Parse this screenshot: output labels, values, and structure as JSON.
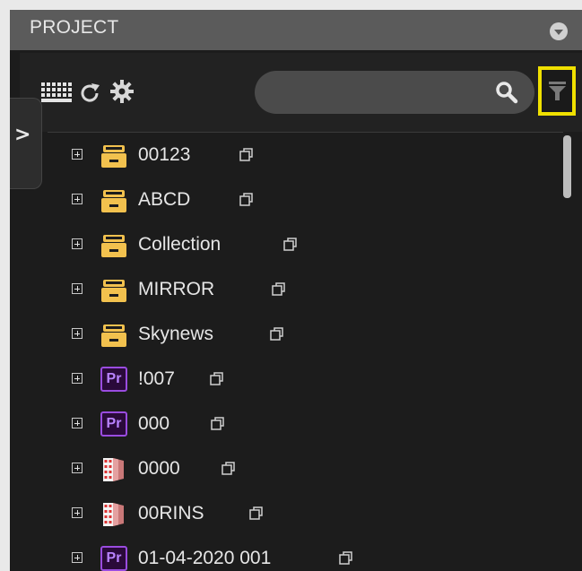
{
  "panel": {
    "title": "PROJECT"
  },
  "search": {
    "placeholder": "",
    "value": ""
  },
  "colors": {
    "header_bg": "#5b5b5b",
    "panel_bg": "#1c1c1c",
    "highlight": "#f0e000",
    "folder": "#f2c14e",
    "premiere": "#9a4ce0"
  },
  "tree": {
    "items": [
      {
        "label": "00123",
        "icon": "archive-box-icon"
      },
      {
        "label": "ABCD",
        "icon": "archive-box-icon"
      },
      {
        "label": "Collection",
        "icon": "archive-box-icon"
      },
      {
        "label": "MIRROR",
        "icon": "archive-box-icon"
      },
      {
        "label": "Skynews",
        "icon": "archive-box-icon"
      },
      {
        "label": "!007",
        "icon": "premiere-pro-icon"
      },
      {
        "label": "000",
        "icon": "premiere-pro-icon"
      },
      {
        "label": "0000",
        "icon": "film-bin-icon"
      },
      {
        "label": "00RINS",
        "icon": "film-bin-icon"
      },
      {
        "label": "01-04-2020 001",
        "icon": "premiere-pro-icon"
      }
    ]
  },
  "icons": {
    "premiere_text": "Pr",
    "side_tab_arrow": ">"
  }
}
